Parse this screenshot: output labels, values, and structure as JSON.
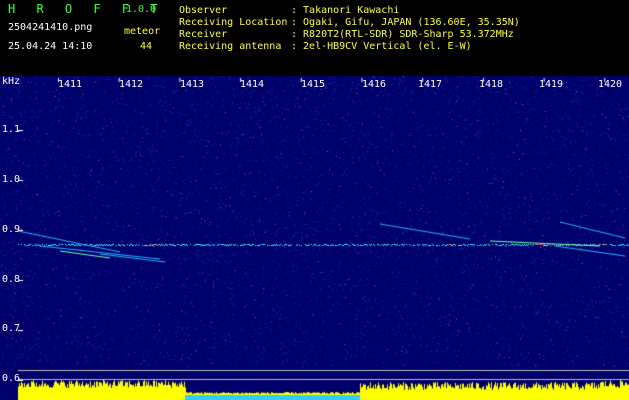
{
  "app": {
    "name": "H R O F F T",
    "version": "1.0.0",
    "filename": "2504241410.png",
    "datetime": "25.04.24 14:10",
    "mode_label": "meteor",
    "count": "44"
  },
  "info": [
    {
      "key": "Observer",
      "value": ": Takanori Kawachi"
    },
    {
      "key": "Receiving Location",
      "value": ": Ogaki, Gifu, JAPAN (136.60E, 35.35N)"
    },
    {
      "key": "Receiver",
      "value": ": R820T2(RTL-SDR) SDR-Sharp 53.372MHz"
    },
    {
      "key": "Receiving antenna",
      "value": ": 2el-HB9CV Vertical (el. E-W)"
    }
  ],
  "axis": {
    "unit": "kHz",
    "y_ticks": [
      "1.1",
      "1.0",
      "0.9",
      "0.8",
      "0.7",
      "0.6"
    ],
    "x_ticks": [
      "1411",
      "1412",
      "1413",
      "1414",
      "1415",
      "1416",
      "1417",
      "1418",
      "1419",
      "1420"
    ]
  },
  "colors": {
    "background": "#000000",
    "spectrum": "#00007a",
    "carrier": "#33ffff",
    "echo": "#ff3333",
    "bars": "#ffff00",
    "title": "#39ff39"
  }
}
